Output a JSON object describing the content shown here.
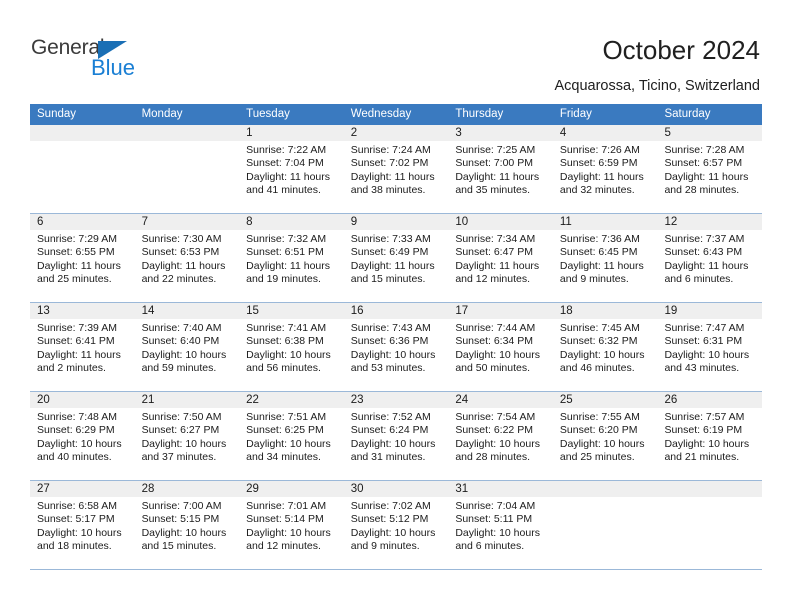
{
  "brand": {
    "name_top": "General",
    "name_bottom": "Blue",
    "triangle_icon": "triangle-icon",
    "accent_color": "#1a7fd4"
  },
  "header": {
    "title": "October 2024",
    "subtitle": "Acquarossa, Ticino, Switzerland"
  },
  "calendar": {
    "header_bg_color": "#3a7ac0",
    "daynum_bg_color": "#efefef",
    "row_border_color": "#9bb8d8",
    "weekdays": [
      "Sunday",
      "Monday",
      "Tuesday",
      "Wednesday",
      "Thursday",
      "Friday",
      "Saturday"
    ],
    "weeks": [
      [
        {
          "day": "",
          "empty": true
        },
        {
          "day": "",
          "empty": true
        },
        {
          "day": "1",
          "sunrise": "Sunrise: 7:22 AM",
          "sunset": "Sunset: 7:04 PM",
          "daylight": "Daylight: 11 hours and 41 minutes."
        },
        {
          "day": "2",
          "sunrise": "Sunrise: 7:24 AM",
          "sunset": "Sunset: 7:02 PM",
          "daylight": "Daylight: 11 hours and 38 minutes."
        },
        {
          "day": "3",
          "sunrise": "Sunrise: 7:25 AM",
          "sunset": "Sunset: 7:00 PM",
          "daylight": "Daylight: 11 hours and 35 minutes."
        },
        {
          "day": "4",
          "sunrise": "Sunrise: 7:26 AM",
          "sunset": "Sunset: 6:59 PM",
          "daylight": "Daylight: 11 hours and 32 minutes."
        },
        {
          "day": "5",
          "sunrise": "Sunrise: 7:28 AM",
          "sunset": "Sunset: 6:57 PM",
          "daylight": "Daylight: 11 hours and 28 minutes."
        }
      ],
      [
        {
          "day": "6",
          "sunrise": "Sunrise: 7:29 AM",
          "sunset": "Sunset: 6:55 PM",
          "daylight": "Daylight: 11 hours and 25 minutes."
        },
        {
          "day": "7",
          "sunrise": "Sunrise: 7:30 AM",
          "sunset": "Sunset: 6:53 PM",
          "daylight": "Daylight: 11 hours and 22 minutes."
        },
        {
          "day": "8",
          "sunrise": "Sunrise: 7:32 AM",
          "sunset": "Sunset: 6:51 PM",
          "daylight": "Daylight: 11 hours and 19 minutes."
        },
        {
          "day": "9",
          "sunrise": "Sunrise: 7:33 AM",
          "sunset": "Sunset: 6:49 PM",
          "daylight": "Daylight: 11 hours and 15 minutes."
        },
        {
          "day": "10",
          "sunrise": "Sunrise: 7:34 AM",
          "sunset": "Sunset: 6:47 PM",
          "daylight": "Daylight: 11 hours and 12 minutes."
        },
        {
          "day": "11",
          "sunrise": "Sunrise: 7:36 AM",
          "sunset": "Sunset: 6:45 PM",
          "daylight": "Daylight: 11 hours and 9 minutes."
        },
        {
          "day": "12",
          "sunrise": "Sunrise: 7:37 AM",
          "sunset": "Sunset: 6:43 PM",
          "daylight": "Daylight: 11 hours and 6 minutes."
        }
      ],
      [
        {
          "day": "13",
          "sunrise": "Sunrise: 7:39 AM",
          "sunset": "Sunset: 6:41 PM",
          "daylight": "Daylight: 11 hours and 2 minutes."
        },
        {
          "day": "14",
          "sunrise": "Sunrise: 7:40 AM",
          "sunset": "Sunset: 6:40 PM",
          "daylight": "Daylight: 10 hours and 59 minutes."
        },
        {
          "day": "15",
          "sunrise": "Sunrise: 7:41 AM",
          "sunset": "Sunset: 6:38 PM",
          "daylight": "Daylight: 10 hours and 56 minutes."
        },
        {
          "day": "16",
          "sunrise": "Sunrise: 7:43 AM",
          "sunset": "Sunset: 6:36 PM",
          "daylight": "Daylight: 10 hours and 53 minutes."
        },
        {
          "day": "17",
          "sunrise": "Sunrise: 7:44 AM",
          "sunset": "Sunset: 6:34 PM",
          "daylight": "Daylight: 10 hours and 50 minutes."
        },
        {
          "day": "18",
          "sunrise": "Sunrise: 7:45 AM",
          "sunset": "Sunset: 6:32 PM",
          "daylight": "Daylight: 10 hours and 46 minutes."
        },
        {
          "day": "19",
          "sunrise": "Sunrise: 7:47 AM",
          "sunset": "Sunset: 6:31 PM",
          "daylight": "Daylight: 10 hours and 43 minutes."
        }
      ],
      [
        {
          "day": "20",
          "sunrise": "Sunrise: 7:48 AM",
          "sunset": "Sunset: 6:29 PM",
          "daylight": "Daylight: 10 hours and 40 minutes."
        },
        {
          "day": "21",
          "sunrise": "Sunrise: 7:50 AM",
          "sunset": "Sunset: 6:27 PM",
          "daylight": "Daylight: 10 hours and 37 minutes."
        },
        {
          "day": "22",
          "sunrise": "Sunrise: 7:51 AM",
          "sunset": "Sunset: 6:25 PM",
          "daylight": "Daylight: 10 hours and 34 minutes."
        },
        {
          "day": "23",
          "sunrise": "Sunrise: 7:52 AM",
          "sunset": "Sunset: 6:24 PM",
          "daylight": "Daylight: 10 hours and 31 minutes."
        },
        {
          "day": "24",
          "sunrise": "Sunrise: 7:54 AM",
          "sunset": "Sunset: 6:22 PM",
          "daylight": "Daylight: 10 hours and 28 minutes."
        },
        {
          "day": "25",
          "sunrise": "Sunrise: 7:55 AM",
          "sunset": "Sunset: 6:20 PM",
          "daylight": "Daylight: 10 hours and 25 minutes."
        },
        {
          "day": "26",
          "sunrise": "Sunrise: 7:57 AM",
          "sunset": "Sunset: 6:19 PM",
          "daylight": "Daylight: 10 hours and 21 minutes."
        }
      ],
      [
        {
          "day": "27",
          "sunrise": "Sunrise: 6:58 AM",
          "sunset": "Sunset: 5:17 PM",
          "daylight": "Daylight: 10 hours and 18 minutes."
        },
        {
          "day": "28",
          "sunrise": "Sunrise: 7:00 AM",
          "sunset": "Sunset: 5:15 PM",
          "daylight": "Daylight: 10 hours and 15 minutes."
        },
        {
          "day": "29",
          "sunrise": "Sunrise: 7:01 AM",
          "sunset": "Sunset: 5:14 PM",
          "daylight": "Daylight: 10 hours and 12 minutes."
        },
        {
          "day": "30",
          "sunrise": "Sunrise: 7:02 AM",
          "sunset": "Sunset: 5:12 PM",
          "daylight": "Daylight: 10 hours and 9 minutes."
        },
        {
          "day": "31",
          "sunrise": "Sunrise: 7:04 AM",
          "sunset": "Sunset: 5:11 PM",
          "daylight": "Daylight: 10 hours and 6 minutes."
        },
        {
          "day": "",
          "empty": true
        },
        {
          "day": "",
          "empty": true
        }
      ]
    ]
  }
}
